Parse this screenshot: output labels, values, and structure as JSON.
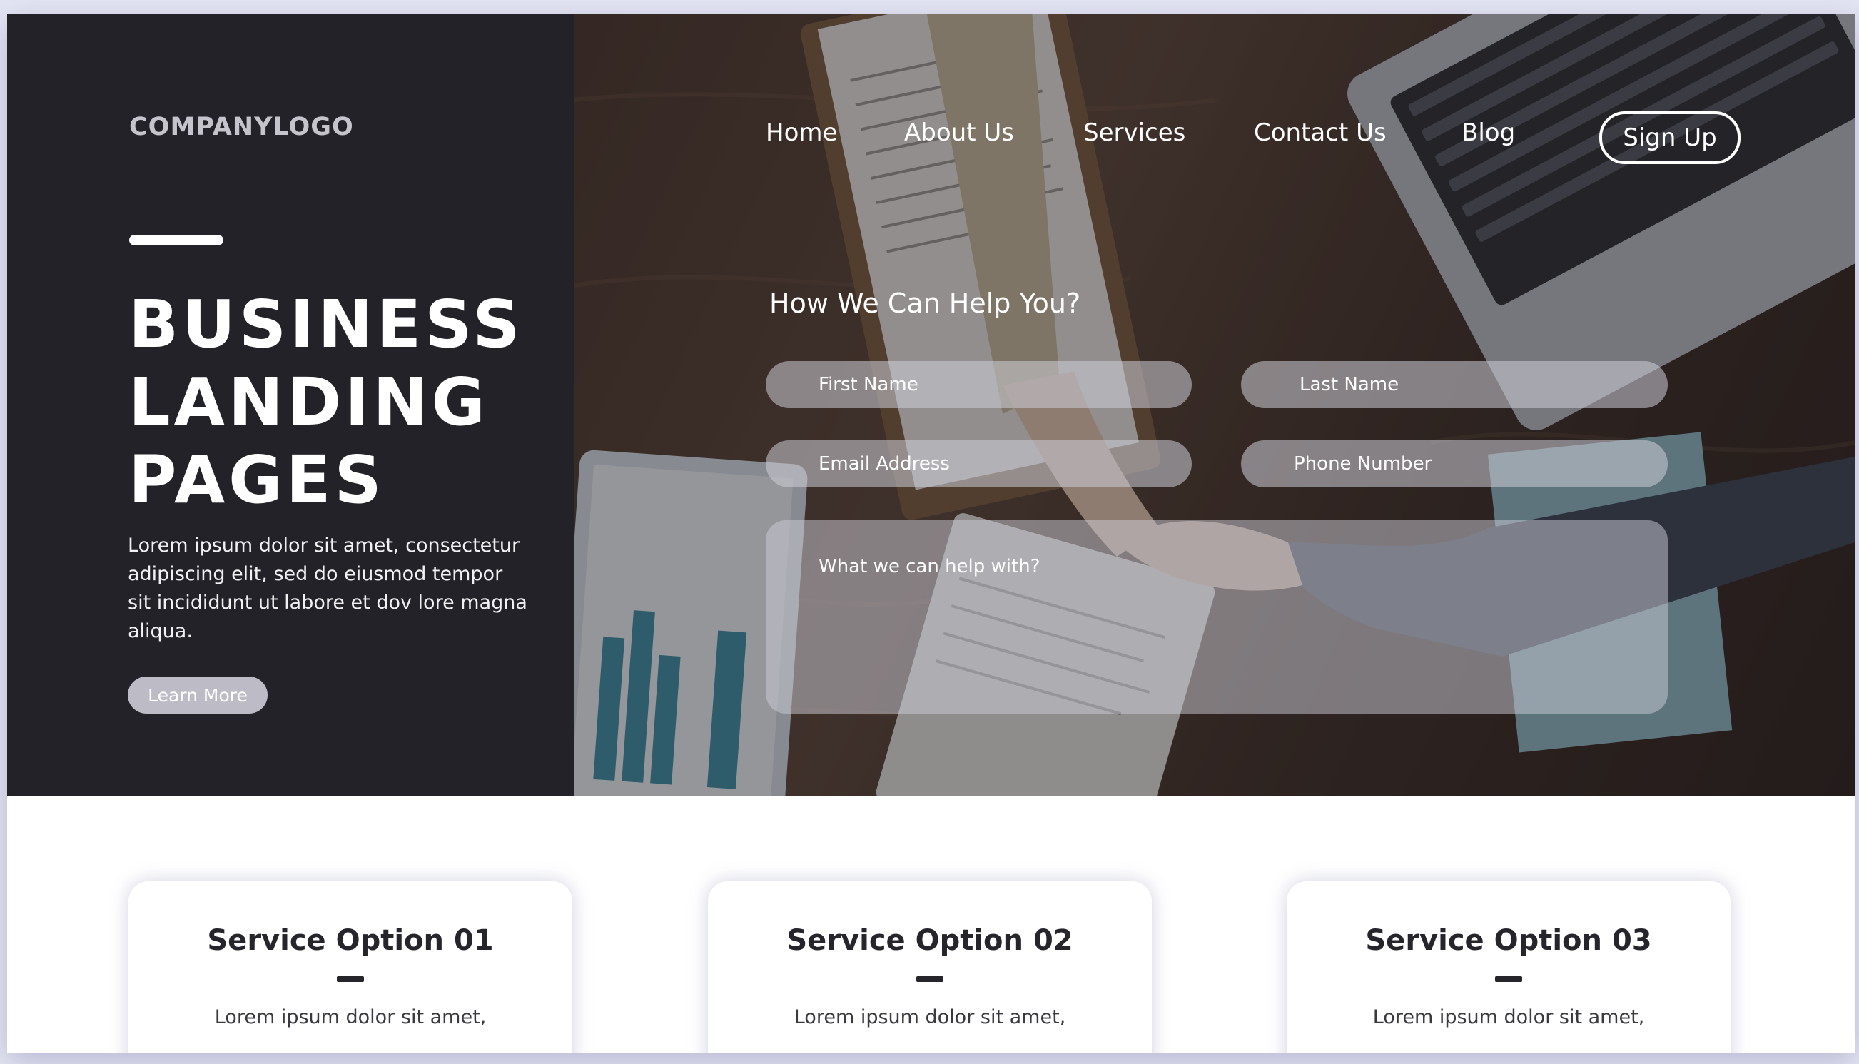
{
  "brand": {
    "logo_text": "COMPANYLOGO"
  },
  "hero": {
    "headline_lines": [
      "BUSINESS",
      "LANDING",
      "PAGES"
    ],
    "intro_text": "Lorem ipsum dolor sit amet, consectetur adipiscing elit, sed do eiusmod tempor sit incididunt ut labore et dov lore magna aliqua.",
    "cta_label": "Learn More"
  },
  "nav": {
    "items": [
      "Home",
      "About Us",
      "Services",
      "Contact Us",
      "Blog"
    ],
    "signup_label": "Sign Up"
  },
  "form": {
    "heading": "How We Can Help You?",
    "first_name_placeholder": "First Name",
    "last_name_placeholder": "Last Name",
    "email_placeholder": "Email Address",
    "phone_placeholder": "Phone Number",
    "message_placeholder": "What we can help with?"
  },
  "services": [
    {
      "title": "Service Option 01",
      "text": "Lorem ipsum dolor sit amet,"
    },
    {
      "title": "Service Option 02",
      "text": "Lorem ipsum dolor sit amet,"
    },
    {
      "title": "Service Option 03",
      "text": "Lorem ipsum dolor sit amet,"
    }
  ],
  "colors": {
    "dark_panel": "#232228",
    "page_background": "#e4e5f3",
    "button_grey": "#bdbcc6",
    "text_dark": "#26252b"
  }
}
